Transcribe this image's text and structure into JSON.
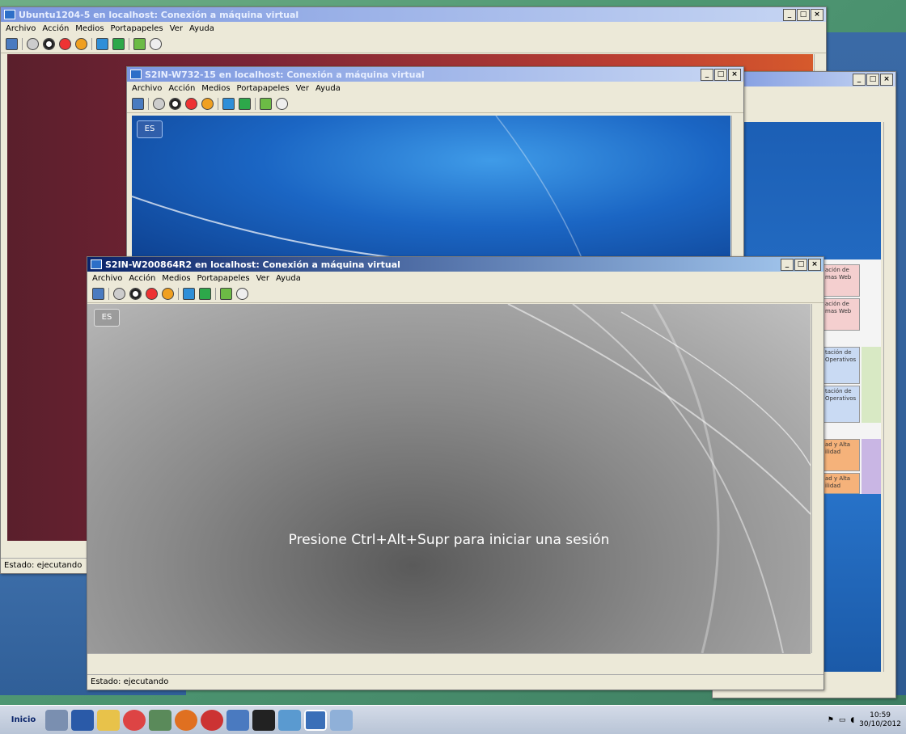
{
  "windows": {
    "ubuntu": {
      "title": "Ubuntu1204-5 en localhost: Conexión a máquina virtual",
      "menu": [
        "Archivo",
        "Acción",
        "Medios",
        "Portapapeles",
        "Ver",
        "Ayuda"
      ],
      "status": "Estado: ejecutando"
    },
    "w7": {
      "title": "S2IN-W732-15 en localhost: Conexión a máquina virtual",
      "menu": [
        "Archivo",
        "Acción",
        "Medios",
        "Portapapeles",
        "Ver",
        "Ayuda"
      ],
      "lang": "ES"
    },
    "w2008": {
      "title": "S2IN-W200864R2 en localhost: Conexión a máquina virtual",
      "menu": [
        "Archivo",
        "Acción",
        "Medios",
        "Portapapeles",
        "Ver",
        "Ayuda"
      ],
      "lang": "ES",
      "login_prompt": "Presione Ctrl+Alt+Supr para iniciar una sesión",
      "status": "Estado: ejecutando"
    },
    "back": {
      "cells": [
        "ación de\nmas Web",
        "ación de\nmas Web",
        "tación de\nOperativos",
        "tación de\nOperativos",
        "ad y Alta\nilidad",
        "ad y Alta\nilidad"
      ]
    }
  },
  "controls": {
    "min": "_",
    "max": "□",
    "close": "×"
  },
  "taskbar": {
    "start": "Inicio",
    "time": "10:59",
    "date": "30/10/2012"
  },
  "colors": {
    "titlebar_active": "#0a246a",
    "desktop": "#3a6aa6"
  }
}
